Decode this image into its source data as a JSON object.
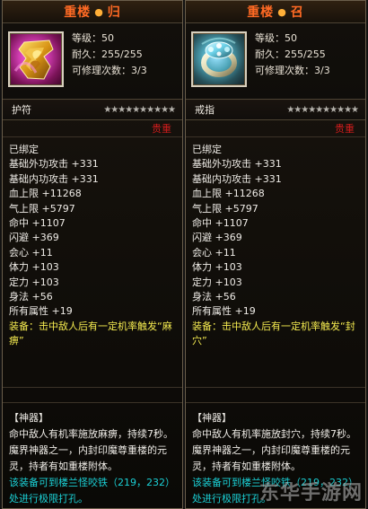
{
  "panels": [
    {
      "id": "left",
      "title_prefix": "重楼",
      "title_suffix": "归",
      "stats": {
        "level": "等级：50",
        "durability": "耐久：255/255",
        "repair": "可修理次数：3/3"
      },
      "name": "护符",
      "stars": "★★★★★★★★★★",
      "quality": "贵重",
      "attributes": [
        "已绑定",
        "基础外功攻击 +331",
        "基础内功攻击 +331",
        "血上限 +11268",
        "气上限 +5797",
        "命中 +1107",
        "闪避 +369",
        "会心 +11",
        "体力 +103",
        "定力 +103",
        "身法 +56",
        "所有属性 +19",
        "装备：击中敌人后有一定机率触发“麻痹”"
      ],
      "desc_title": "【神器】",
      "desc_line1": "命中敌人有机率施放麻痹，持续7秒。",
      "desc_line2": "魔界神器之一，内封印魔尊重楼的元灵，持者有如重楼附体。",
      "desc_line3": "该装备可到楼兰怪咬铁（219，232）处进行极限打孔。"
    },
    {
      "id": "right",
      "title_prefix": "重楼",
      "title_suffix": "召",
      "stats": {
        "level": "等级：50",
        "durability": "耐久：255/255",
        "repair": "可修理次数：3/3"
      },
      "name": "戒指",
      "stars": "★★★★★★★★★★",
      "quality": "贵重",
      "attributes": [
        "已绑定",
        "基础外功攻击 +331",
        "基础内功攻击 +331",
        "血上限 +11268",
        "气上限 +5797",
        "命中 +1107",
        "闪避 +369",
        "会心 +11",
        "体力 +103",
        "定力 +103",
        "身法 +56",
        "所有属性 +19",
        "装备：击中敌人后有一定机率触发“封穴”"
      ],
      "desc_title": "【神器】",
      "desc_line1": "命中敌人有机率施放封穴，持续7秒。",
      "desc_line2": "魔界神器之一，内封印魔尊重楼的元灵，持者有如重楼附体。",
      "desc_line3": "该装备可到楼兰怪咬铁（219，232）处进行极限打孔。"
    }
  ],
  "watermark": "东华手游网"
}
